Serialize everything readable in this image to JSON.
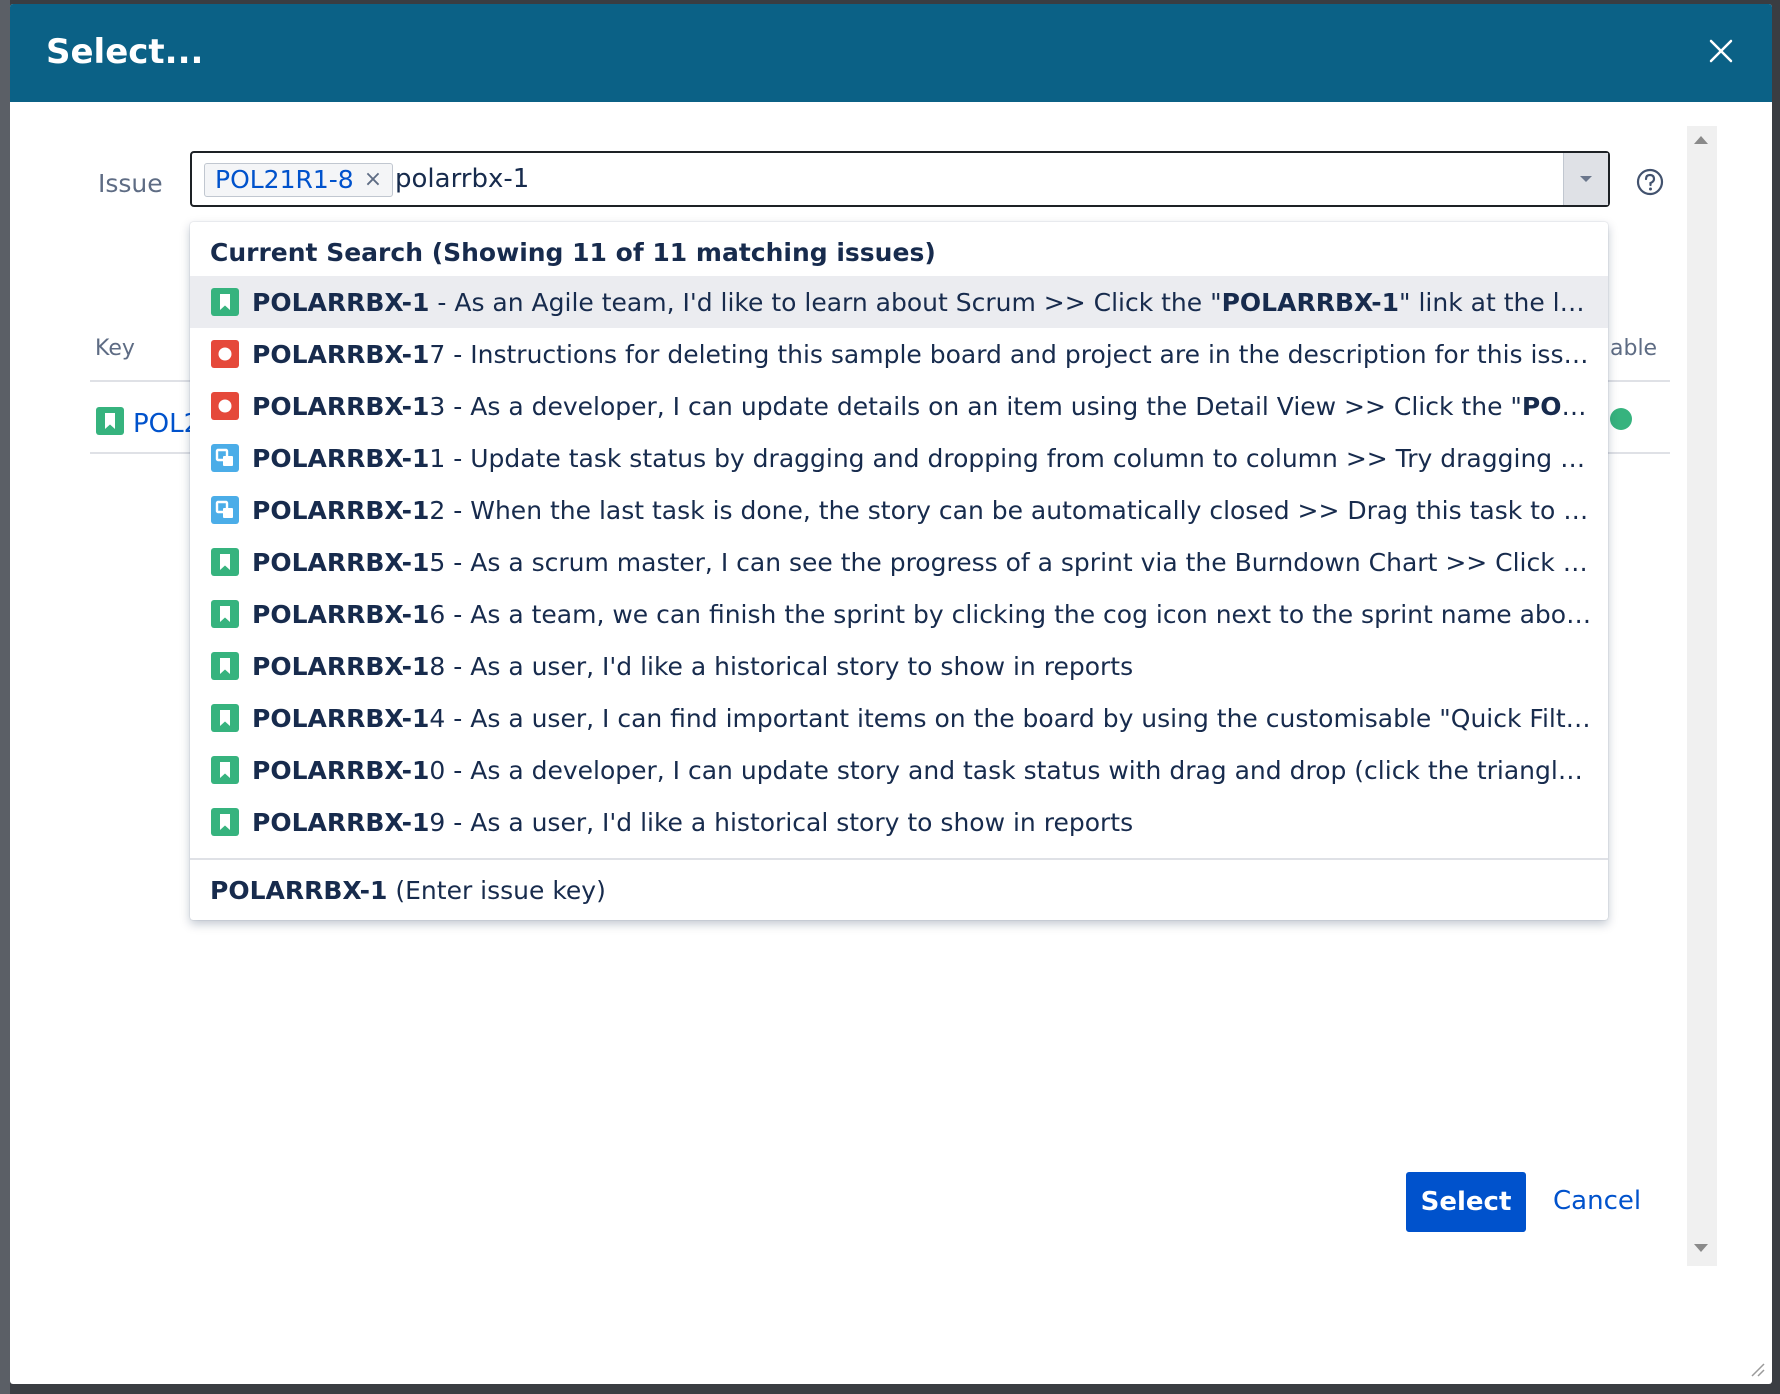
{
  "dialog": {
    "title": "Select...",
    "select_label": "Select",
    "cancel_label": "Cancel"
  },
  "issue_field": {
    "label": "Issue",
    "selected_token": "POL21R1-8",
    "token_remove_glyph": "×",
    "query": "polarrbx-1"
  },
  "background_table": {
    "key_header": "Key",
    "right_header_fragment": "able",
    "row_key_fragment": "POL2"
  },
  "suggestions": {
    "heading": "Current Search (Showing 11 of 11 matching issues)",
    "items": [
      {
        "type": "story",
        "key": "POLARRBX-1",
        "match": "POLARRBX-1",
        "rest": "",
        "summary_pre": " - As an Agile team, I'd like to learn about Scrum >> Click the \"",
        "summary_bold": "POLARRBX-1",
        "summary_post": "\" link at the left..."
      },
      {
        "type": "bug",
        "key": "POLARRBX-17",
        "match": "POLARRBX-1",
        "rest": "7",
        "summary_pre": " - Instructions for deleting this sample board and project are in the description for this issu...",
        "summary_bold": "",
        "summary_post": ""
      },
      {
        "type": "bug",
        "key": "POLARRBX-13",
        "match": "POLARRBX-1",
        "rest": "3",
        "summary_pre": " - As a developer, I can update details on an item using the Detail View >> Click the \"",
        "summary_bold": "POLA...",
        "summary_post": ""
      },
      {
        "type": "subtask",
        "key": "POLARRBX-11",
        "match": "POLARRBX-1",
        "rest": "1",
        "summary_pre": " - Update task status by dragging and dropping from column to column >> Try dragging t...",
        "summary_bold": "",
        "summary_post": ""
      },
      {
        "type": "subtask",
        "key": "POLARRBX-12",
        "match": "POLARRBX-1",
        "rest": "2",
        "summary_pre": " - When the last task is done, the story can be automatically closed >> Drag this task to \"D...",
        "summary_bold": "",
        "summary_post": ""
      },
      {
        "type": "story",
        "key": "POLARRBX-15",
        "match": "POLARRBX-1",
        "rest": "5",
        "summary_pre": " - As a scrum master, I can see the progress of a sprint via the Burndown Chart >> Click \"R...",
        "summary_bold": "",
        "summary_post": ""
      },
      {
        "type": "story",
        "key": "POLARRBX-16",
        "match": "POLARRBX-1",
        "rest": "6",
        "summary_pre": " - As a team, we can finish the sprint by clicking the cog icon next to the sprint name above...",
        "summary_bold": "",
        "summary_post": ""
      },
      {
        "type": "story",
        "key": "POLARRBX-18",
        "match": "POLARRBX-1",
        "rest": "8",
        "summary_pre": " - As a user, I'd like a historical story to show in reports",
        "summary_bold": "",
        "summary_post": ""
      },
      {
        "type": "story",
        "key": "POLARRBX-14",
        "match": "POLARRBX-1",
        "rest": "4",
        "summary_pre": " - As a user, I can find important items on the board by using the customisable \"Quick Filte...",
        "summary_bold": "",
        "summary_post": ""
      },
      {
        "type": "story",
        "key": "POLARRBX-10",
        "match": "POLARRBX-1",
        "rest": "0",
        "summary_pre": " - As a developer, I can update story and task status with drag and drop (click the triangle a...",
        "summary_bold": "",
        "summary_post": ""
      },
      {
        "type": "story",
        "key": "POLARRBX-19",
        "match": "POLARRBX-1",
        "rest": "9",
        "summary_pre": " - As a user, I'd like a historical story to show in reports",
        "summary_bold": "",
        "summary_post": ""
      }
    ],
    "footer_key": "POLARRBX-1",
    "footer_hint": " (Enter issue key)"
  },
  "icons": {
    "close": "close-icon",
    "help": "help-icon",
    "dropdown": "chevron-down-icon",
    "story": "story-icon",
    "bug": "bug-icon",
    "subtask": "subtask-icon"
  },
  "colors": {
    "header": "#0b6186",
    "primary": "#0052cc",
    "story": "#36b37e",
    "bug": "#e5493a",
    "subtask": "#4bade8"
  }
}
